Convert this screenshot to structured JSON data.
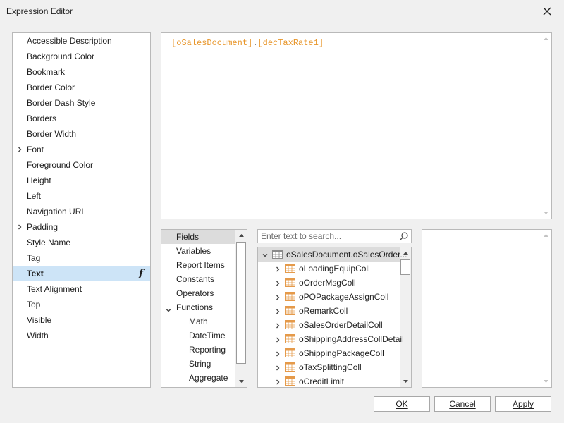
{
  "window": {
    "title": "Expression Editor"
  },
  "properties": [
    {
      "label": "Accessible Description",
      "expandable": false,
      "selected": false
    },
    {
      "label": "Background Color",
      "expandable": false,
      "selected": false
    },
    {
      "label": "Bookmark",
      "expandable": false,
      "selected": false
    },
    {
      "label": "Border Color",
      "expandable": false,
      "selected": false
    },
    {
      "label": "Border Dash Style",
      "expandable": false,
      "selected": false
    },
    {
      "label": "Borders",
      "expandable": false,
      "selected": false
    },
    {
      "label": "Border Width",
      "expandable": false,
      "selected": false
    },
    {
      "label": "Font",
      "expandable": true,
      "selected": false
    },
    {
      "label": "Foreground Color",
      "expandable": false,
      "selected": false
    },
    {
      "label": "Height",
      "expandable": false,
      "selected": false
    },
    {
      "label": "Left",
      "expandable": false,
      "selected": false
    },
    {
      "label": "Navigation URL",
      "expandable": false,
      "selected": false
    },
    {
      "label": "Padding",
      "expandable": true,
      "selected": false
    },
    {
      "label": "Style Name",
      "expandable": false,
      "selected": false
    },
    {
      "label": "Tag",
      "expandable": false,
      "selected": false
    },
    {
      "label": "Text",
      "expandable": false,
      "selected": true,
      "has_expression": true
    },
    {
      "label": "Text Alignment",
      "expandable": false,
      "selected": false
    },
    {
      "label": "Top",
      "expandable": false,
      "selected": false
    },
    {
      "label": "Visible",
      "expandable": false,
      "selected": false
    },
    {
      "label": "Width",
      "expandable": false,
      "selected": false
    }
  ],
  "expression": {
    "field1": "[oSalesDocument]",
    "separator": ".",
    "field2": "[decTaxRate1]"
  },
  "categories": [
    {
      "label": "Fields",
      "selected": true,
      "level": 0,
      "expander": "none"
    },
    {
      "label": "Variables",
      "selected": false,
      "level": 0,
      "expander": "none"
    },
    {
      "label": "Report Items",
      "selected": false,
      "level": 0,
      "expander": "none"
    },
    {
      "label": "Constants",
      "selected": false,
      "level": 0,
      "expander": "none"
    },
    {
      "label": "Operators",
      "selected": false,
      "level": 0,
      "expander": "none"
    },
    {
      "label": "Functions",
      "selected": false,
      "level": 0,
      "expander": "expanded"
    },
    {
      "label": "Math",
      "selected": false,
      "level": 1,
      "expander": "none"
    },
    {
      "label": "DateTime",
      "selected": false,
      "level": 1,
      "expander": "none"
    },
    {
      "label": "Reporting",
      "selected": false,
      "level": 1,
      "expander": "none"
    },
    {
      "label": "String",
      "selected": false,
      "level": 1,
      "expander": "none"
    },
    {
      "label": "Aggregate",
      "selected": false,
      "level": 1,
      "expander": "none"
    }
  ],
  "search": {
    "placeholder": "Enter text to search...",
    "value": ""
  },
  "fields": [
    {
      "label": "oSalesDocument.oSalesOrder...",
      "level": 0,
      "expander": "expanded",
      "selected": true
    },
    {
      "label": "oLoadingEquipColl",
      "level": 1,
      "expander": "collapsed",
      "selected": false
    },
    {
      "label": "oOrderMsgColl",
      "level": 1,
      "expander": "collapsed",
      "selected": false
    },
    {
      "label": "oPOPackageAssignColl",
      "level": 1,
      "expander": "collapsed",
      "selected": false
    },
    {
      "label": "oRemarkColl",
      "level": 1,
      "expander": "collapsed",
      "selected": false
    },
    {
      "label": "oSalesOrderDetailColl",
      "level": 1,
      "expander": "collapsed",
      "selected": false
    },
    {
      "label": "oShippingAddressCollDetail",
      "level": 1,
      "expander": "collapsed",
      "selected": false
    },
    {
      "label": "oShippingPackageColl",
      "level": 1,
      "expander": "collapsed",
      "selected": false
    },
    {
      "label": "oTaxSplittingColl",
      "level": 1,
      "expander": "collapsed",
      "selected": false
    },
    {
      "label": "oCreditLimit",
      "level": 1,
      "expander": "collapsed",
      "selected": false
    }
  ],
  "buttons": {
    "ok": "OK",
    "cancel": "Cancel",
    "apply": "Apply"
  },
  "colors": {
    "expression_token": "#e8962a",
    "selection_blue": "#cde4f7",
    "selection_gray": "#dcdcdc",
    "table_icon_orange": "#e59a4a",
    "table_icon_gray": "#8a8a8a"
  },
  "icons": {
    "close": "close-icon",
    "expand": "chevron-right-icon",
    "collapse": "chevron-down-icon",
    "expression": "function-icon",
    "search": "search-icon",
    "table": "table-icon"
  }
}
